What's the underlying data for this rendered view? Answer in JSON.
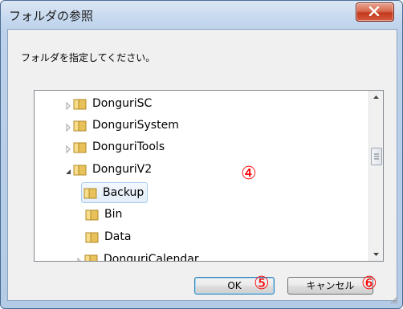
{
  "window": {
    "title": "フォルダの参照",
    "description": "フォルダを指定してください。"
  },
  "tree": {
    "items": [
      {
        "label": "DonguriSC",
        "expanded": false,
        "selected": false
      },
      {
        "label": "DonguriSystem",
        "expanded": false,
        "selected": false
      },
      {
        "label": "DonguriTools",
        "expanded": false,
        "selected": false
      },
      {
        "label": "DonguriV2",
        "expanded": true,
        "selected": false
      },
      {
        "label": "Backup",
        "expanded": null,
        "selected": true
      },
      {
        "label": "Bin",
        "expanded": null,
        "selected": false
      },
      {
        "label": "Data",
        "expanded": null,
        "selected": false
      },
      {
        "label": "DonguriCalendar",
        "expanded": false,
        "selected": false
      }
    ]
  },
  "buttons": {
    "ok_label": "OK",
    "cancel_label": "キャンセル"
  },
  "annotations": {
    "tree_marker": "④",
    "ok_marker": "⑤",
    "cancel_marker": "⑥"
  },
  "colors": {
    "selection": "#e3eef9",
    "marker": "#ff0000",
    "close_button": "#c23a1e"
  }
}
